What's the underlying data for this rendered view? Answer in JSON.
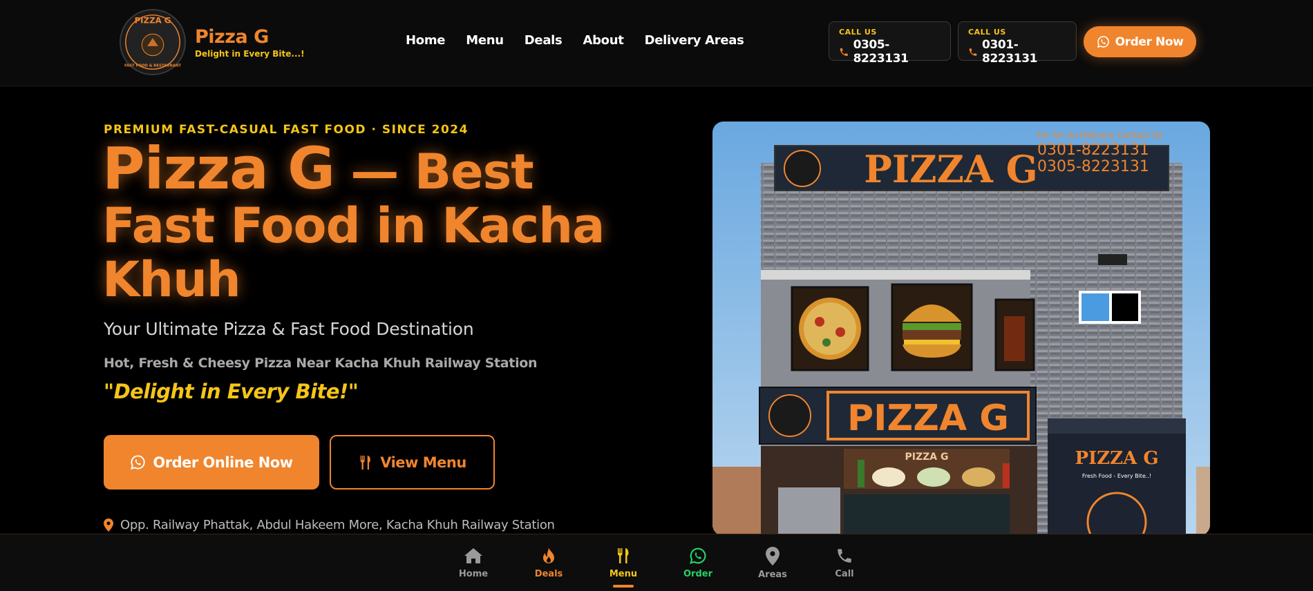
{
  "header": {
    "brand_name": "Pizza G",
    "brand_tagline": "Delight in Every Bite...!",
    "logo_text": "PIZZA G",
    "logo_ring_text": "FAST FOOD & RESTAURANT",
    "nav": [
      "Home",
      "Menu",
      "Deals",
      "About",
      "Delivery Areas"
    ],
    "calls": [
      {
        "label": "CALL US",
        "number": "0305-8223131"
      },
      {
        "label": "CALL US",
        "number": "0301-8223131"
      }
    ],
    "order_label": "Order Now"
  },
  "hero": {
    "eyebrow": "PREMIUM FAST-CASUAL FAST FOOD · SINCE 2024",
    "title_line1_a": "Pizza G",
    "title_line1_b": " — Best",
    "title_line2": "Fast Food in Kacha",
    "title_line3": "Khuh",
    "subtitle": "Your Ultimate Pizza & Fast Food Destination",
    "subline": "Hot, Fresh & Cheesy Pizza Near Kacha Khuh Railway Station",
    "slogan": "\"Delight in Every Bite!\"",
    "cta_primary": "Order Online Now",
    "cta_secondary": "View Menu",
    "address": "Opp. Railway Phattak, Abdul Hakeem More, Kacha Khuh Railway Station"
  },
  "storefront": {
    "top_sign": "PIZZA G",
    "top_sign_contact": "For for An Delivery Contact Us",
    "top_sign_numbers": [
      "0301-8223131",
      "0305-8223131"
    ],
    "mid_sign": "PIZZA G",
    "right_sign": "PIZZA G",
    "right_sign_tag": "Fresh Food - Every Bite..!",
    "lower_sign": "PIZZA G"
  },
  "bottom_nav": {
    "items": [
      {
        "label": "Home",
        "icon": "home-icon",
        "color": "#9a9a9a"
      },
      {
        "label": "Deals",
        "icon": "flame-icon",
        "color": "#f0852d"
      },
      {
        "label": "Menu",
        "icon": "utensils-icon",
        "color": "#f5c518"
      },
      {
        "label": "Order",
        "icon": "whatsapp-icon",
        "color": "#25d366"
      },
      {
        "label": "Areas",
        "icon": "map-pin-icon",
        "color": "#9a9a9a"
      },
      {
        "label": "Call",
        "icon": "phone-icon",
        "color": "#9a9a9a"
      }
    ],
    "active": "Menu"
  },
  "colors": {
    "accent": "#f0852d",
    "highlight": "#f5c518",
    "background": "#000000",
    "whatsapp": "#25d366"
  }
}
